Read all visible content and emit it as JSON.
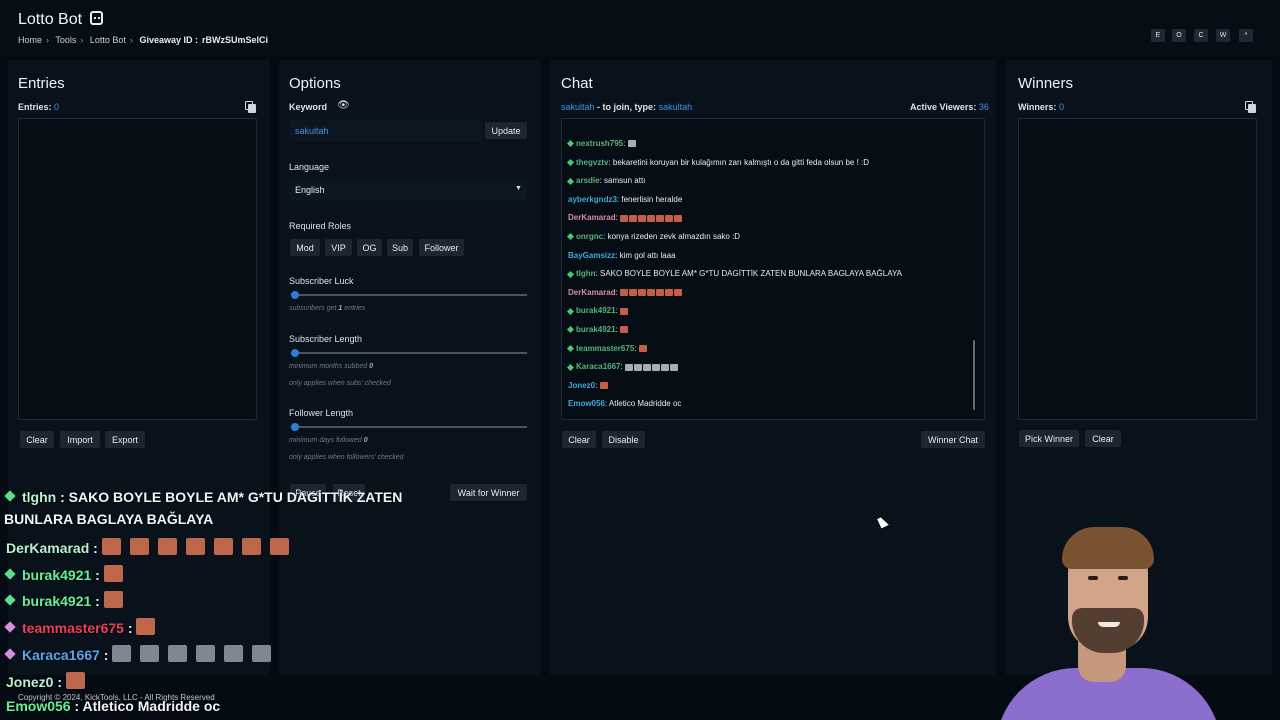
{
  "header": {
    "title": "Lotto Bot",
    "breadcrumb": [
      "Home",
      "Tools",
      "Lotto Bot",
      "Giveaway ID :",
      "rBWzSUmSelCi"
    ],
    "controls": [
      "E",
      "O",
      "C",
      "W",
      "*"
    ]
  },
  "entries": {
    "title": "Entries",
    "count_label": "Entries:",
    "count": "0",
    "buttons": [
      "Clear",
      "Import",
      "Export"
    ]
  },
  "options": {
    "title": "Options",
    "keyword_label": "Keyword",
    "keyword_value": "sakultah",
    "update_label": "Update",
    "language_label": "Language",
    "language_value": "English",
    "roles_label": "Required Roles",
    "roles": [
      "Mod",
      "VIP",
      "OG",
      "Sub",
      "Follower"
    ],
    "sub_luck_label": "Subscriber Luck",
    "sub_luck_hint_prefix": "subscribers get",
    "sub_luck_value": "1",
    "sub_luck_hint_suffix": "entries",
    "sub_length_label": "Subscriber Length",
    "sub_length_hint": "minimum months subbed",
    "sub_length_value": "0",
    "sub_length_note": "only applies when subs' checked",
    "follower_length_label": "Follower Length",
    "follower_length_hint": "minimum days followed",
    "follower_length_value": "0",
    "follower_length_note": "only applies when followers' checked",
    "pause_label": "Pause",
    "reset_label": "Reset",
    "wait_label": "Wait for Winner"
  },
  "chat": {
    "title": "Chat",
    "join_user": "sakultah",
    "join_text": "- to join, type:",
    "join_keyword": "sakultah",
    "viewers_label": "Active Viewers:",
    "viewers": "36",
    "messages": [
      {
        "user": "nextrush795",
        "text": "",
        "badge": true,
        "emotes": 1,
        "emote_color": "gray"
      },
      {
        "user": "thegvztv",
        "text": "bekaretini koruyan bir kulağımın zarı kalmıştı o da gitti feda olsun be ! :D",
        "badge": true,
        "emotes": 0
      },
      {
        "user": "arsdie",
        "text": "samsun attı",
        "badge": true,
        "emotes": 0
      },
      {
        "user": "ayberkgndz3",
        "text": "fenerlisin heralde",
        "badge": false,
        "emotes": 0
      },
      {
        "user": "DerKamarad",
        "text": "",
        "badge": false,
        "emotes": 7
      },
      {
        "user": "onrgnc",
        "text": "konya rizeden zevk almazdın sako :D",
        "badge": true,
        "emotes": 0
      },
      {
        "user": "BayGamsizz",
        "text": "kim gol attı laaa",
        "badge": false,
        "emotes": 0
      },
      {
        "user": "tlghn",
        "text": "SAKO BOYLE BOYLE AM* G*TU DAGİTTİK ZATEN BUNLARA BAGLAYA BAĞLAYA",
        "badge": true,
        "emotes": 0
      },
      {
        "user": "DerKamarad",
        "text": "",
        "badge": false,
        "emotes": 7
      },
      {
        "user": "burak4921",
        "text": "",
        "badge": true,
        "emotes": 1
      },
      {
        "user": "burak4921",
        "text": "",
        "badge": true,
        "emotes": 1
      },
      {
        "user": "teammaster675",
        "text": "",
        "badge": true,
        "emotes": 1
      },
      {
        "user": "Karaca1667",
        "text": "",
        "badge": true,
        "emotes": 6,
        "emote_color": "gray"
      },
      {
        "user": "Jonez0",
        "text": "",
        "badge": false,
        "emotes": 1
      },
      {
        "user": "Emow056",
        "text": "Atletico Madridde oc",
        "badge": false,
        "emotes": 0
      }
    ],
    "clear_label": "Clear",
    "disable_label": "Disable",
    "winner_chat_label": "Winner Chat"
  },
  "winners": {
    "title": "Winners",
    "count_label": "Winners:",
    "count": "0",
    "pick_label": "Pick Winner",
    "clear_label": "Clear"
  },
  "overlay": {
    "line1_user": "tlghn",
    "line1_text": "SAKO BOYLE BOYLE AM* G*TU DAGİTTİK ZATEN",
    "line2_text": "BUNLARA BAGLAYA BAĞLAYA",
    "messages": [
      {
        "user": "DerKamarad",
        "emotes": 7,
        "color": "default",
        "badge": ""
      },
      {
        "user": "burak4921",
        "emotes": 1,
        "color": "green",
        "badge": "green"
      },
      {
        "user": "burak4921",
        "emotes": 1,
        "color": "green",
        "badge": "green"
      },
      {
        "user": "teammaster675",
        "emotes": 1,
        "color": "red",
        "badge": "pink"
      },
      {
        "user": "Karaca1667",
        "emotes": 6,
        "color": "blue",
        "badge": "pink"
      },
      {
        "user": "Jonez0",
        "emotes": 1,
        "color": "default",
        "badge": ""
      }
    ],
    "last_user": "Emow056",
    "last_text": "Atletico Madridde oc"
  },
  "footer": {
    "copyright": "Copyright © 2024, KickTools, LLC - All Rights Reserved"
  }
}
